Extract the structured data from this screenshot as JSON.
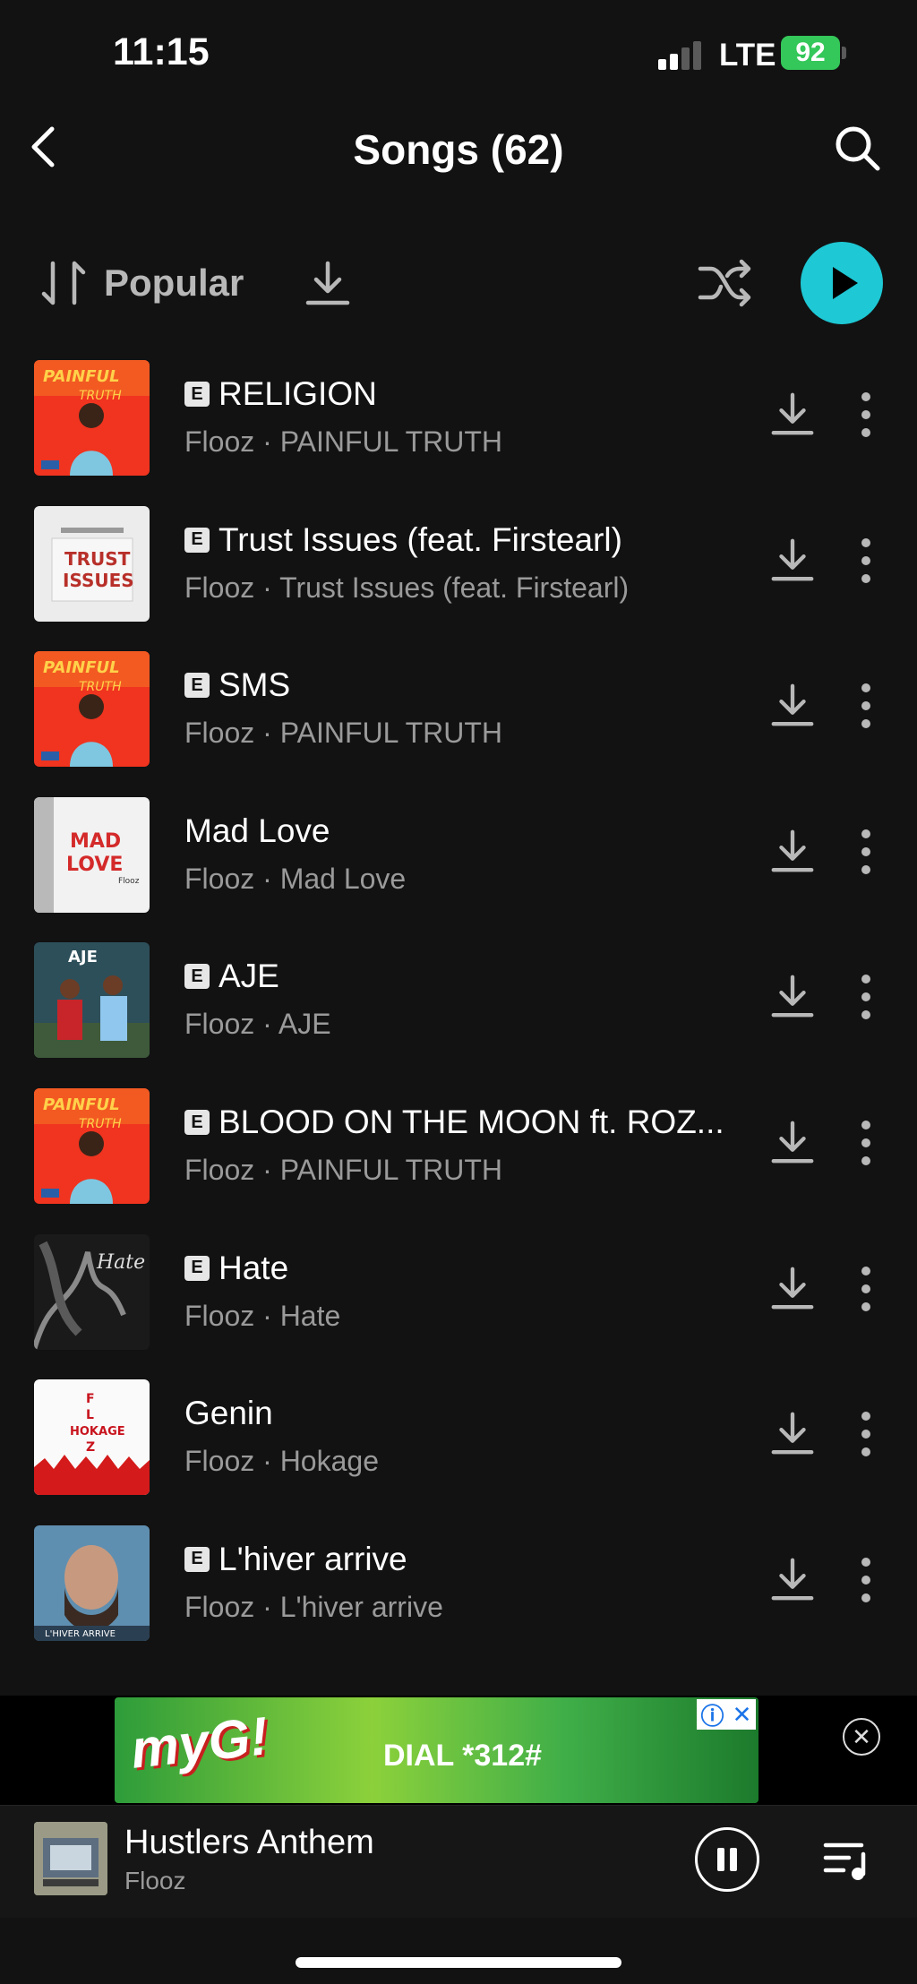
{
  "status": {
    "time": "11:15",
    "network": "LTE",
    "battery": "92"
  },
  "header": {
    "title": "Songs (62)"
  },
  "toolbar": {
    "sort_label": "Popular"
  },
  "colors": {
    "accent": "#1ec8d4",
    "background": "#121212",
    "battery": "#34c759"
  },
  "songs": [
    {
      "title": "RELIGION",
      "subtitle": "Flooz · PAINFUL TRUTH",
      "explicit": true,
      "art": "painful-truth"
    },
    {
      "title": "Trust Issues (feat. Firstearl)",
      "subtitle": "Flooz · Trust Issues (feat. Firstearl)",
      "explicit": true,
      "art": "trust-issues"
    },
    {
      "title": "SMS",
      "subtitle": "Flooz · PAINFUL TRUTH",
      "explicit": true,
      "art": "painful-truth"
    },
    {
      "title": "Mad Love",
      "subtitle": "Flooz · Mad Love",
      "explicit": false,
      "art": "mad-love"
    },
    {
      "title": "AJE",
      "subtitle": "Flooz · AJE",
      "explicit": true,
      "art": "aje"
    },
    {
      "title": "BLOOD ON THE MOON ft. ROZ...",
      "subtitle": "Flooz · PAINFUL TRUTH",
      "explicit": true,
      "art": "painful-truth"
    },
    {
      "title": "Hate",
      "subtitle": "Flooz · Hate",
      "explicit": true,
      "art": "hate"
    },
    {
      "title": "Genin",
      "subtitle": "Flooz · Hokage",
      "explicit": false,
      "art": "hokage"
    },
    {
      "title": "L'hiver arrive",
      "subtitle": "Flooz · L'hiver arrive",
      "explicit": true,
      "art": "hiver"
    }
  ],
  "ad": {
    "logo": "myG!",
    "text": "DIAL *312#"
  },
  "now_playing": {
    "title": "Hustlers Anthem",
    "artist": "Flooz"
  }
}
